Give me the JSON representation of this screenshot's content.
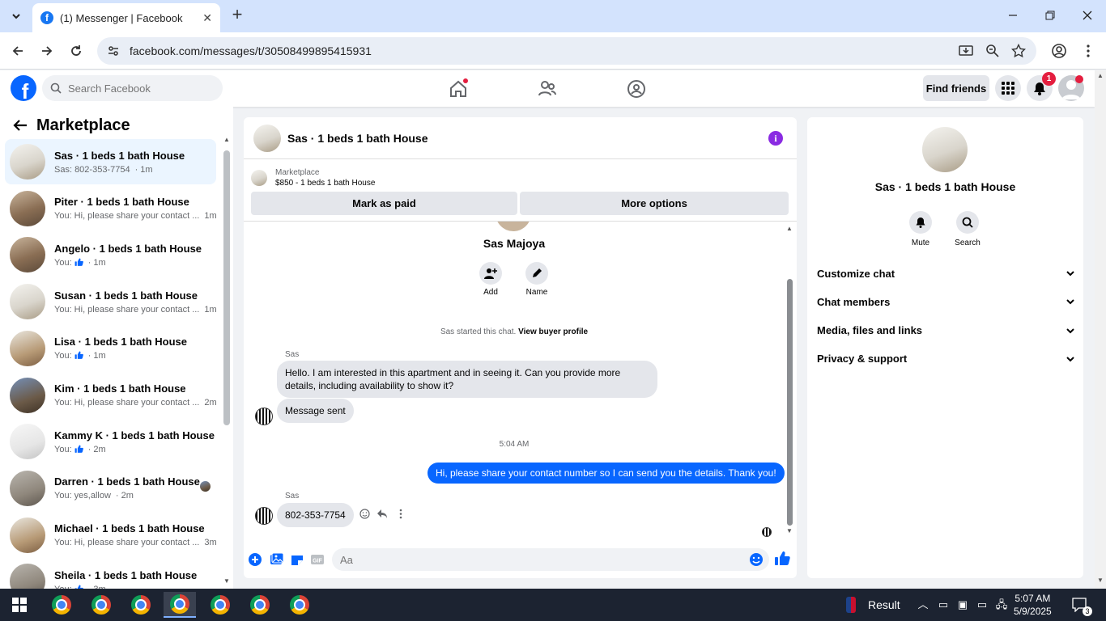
{
  "browser": {
    "tab_title": "(1) Messenger | Facebook",
    "url": "facebook.com/messages/t/30508499895415931"
  },
  "fb": {
    "search_placeholder": "Search Facebook",
    "find_friends": "Find friends",
    "notif_count": "1"
  },
  "sidebar": {
    "title": "Marketplace",
    "conversations": [
      {
        "name": "Sas · 1 beds 1 bath House",
        "preview": "Sas: 802-353-7754",
        "time": "· 1m",
        "active": true
      },
      {
        "name": "Piter · 1 beds 1 bath House",
        "preview": "You: Hi, please share your contact ...",
        "time": "1m"
      },
      {
        "name": "Angelo · 1 beds 1 bath House",
        "preview": "You:",
        "time": "· 1m",
        "like": true
      },
      {
        "name": "Susan · 1 beds 1 bath House",
        "preview": "You: Hi, please share your contact ...",
        "time": "1m"
      },
      {
        "name": "Lisa · 1 beds 1 bath House",
        "preview": "You:",
        "time": "· 1m",
        "like": true
      },
      {
        "name": "Kim · 1 beds 1 bath House",
        "preview": "You: Hi, please share your contact ...",
        "time": "2m"
      },
      {
        "name": "Kammy K · 1 beds 1 bath House",
        "preview": "You:",
        "time": "· 2m",
        "like": true
      },
      {
        "name": "Darren · 1 beds 1 bath House",
        "preview": "You: yes,allow",
        "time": "· 2m"
      },
      {
        "name": "Michael · 1 beds 1 bath House",
        "preview": "You: Hi, please share your contact ...",
        "time": "3m"
      },
      {
        "name": "Sheila · 1 beds 1 bath House",
        "preview": "You:",
        "time": "· 3m",
        "like": true
      }
    ]
  },
  "chat": {
    "title": "Sas · 1 beds 1 bath House",
    "marketplace_label": "Marketplace",
    "listing": "$850 - 1 beds 1 bath House",
    "mark_paid": "Mark as paid",
    "more_options": "More options",
    "buyer_name": "Sas Majoya",
    "add_label": "Add",
    "name_label": "Name",
    "started_text": "Sas started this chat.",
    "view_profile": "View buyer profile",
    "sender_1": "Sas",
    "msg_1": "Hello. I am interested in this apartment and in seeing it. Can you provide more details, including availability to show it?",
    "msg_2": "Message sent",
    "timestamp": "5:04 AM",
    "msg_out": "Hi, please share your contact number so I can send you the details. Thank you!",
    "sender_2": "Sas",
    "msg_3": "802-353-7754",
    "input_placeholder": "Aa"
  },
  "details": {
    "name": "Sas · 1 beds 1 bath House",
    "mute": "Mute",
    "search": "Search",
    "sections": [
      "Customize chat",
      "Chat members",
      "Media, files and links",
      "Privacy & support"
    ]
  },
  "taskbar": {
    "result": "Result",
    "time": "5:07 AM",
    "date": "5/9/2025",
    "notif": "3"
  },
  "colors": {
    "fb_blue": "#0866ff",
    "active_conv": "#ebf5ff",
    "info_purple": "#8a2be2"
  }
}
